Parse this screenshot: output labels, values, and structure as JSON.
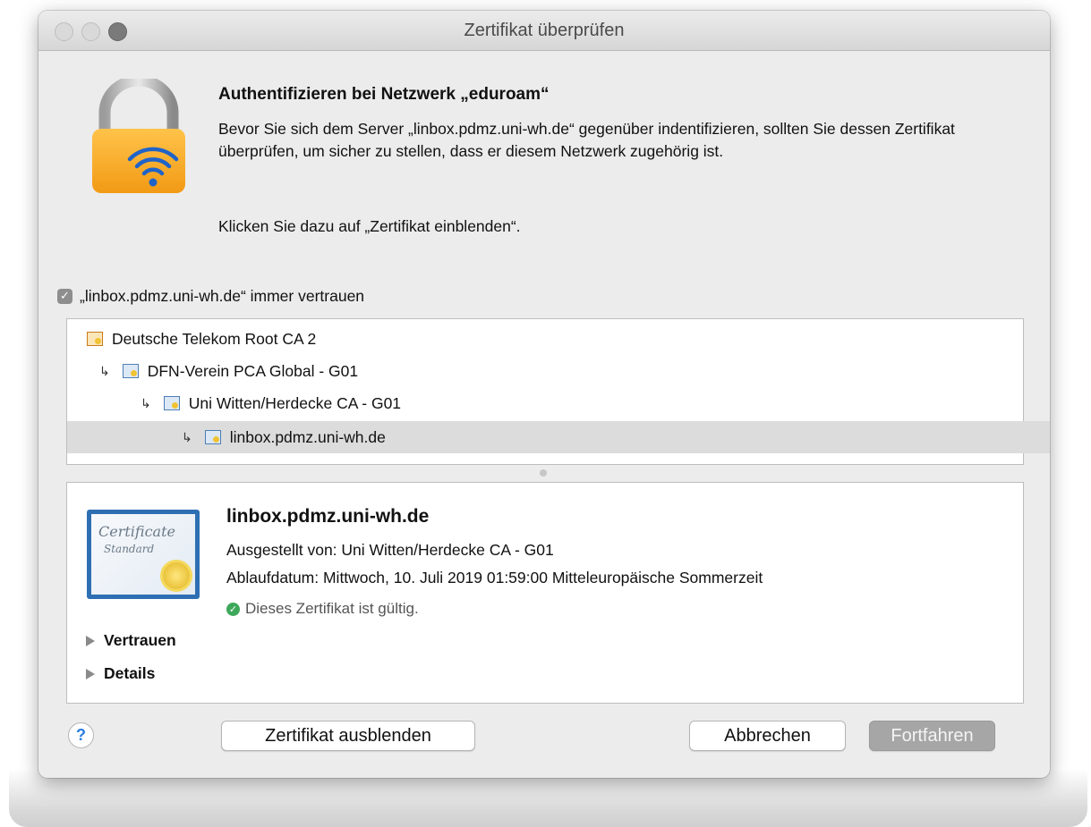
{
  "window": {
    "title": "Zertifikat überprüfen"
  },
  "header": {
    "title": "Authentifizieren bei Netzwerk „eduroam“",
    "description": "Bevor Sie sich dem Server „linbox.pdmz.uni-wh.de“ gegenüber indentifizieren, sollten Sie dessen Zertifikat überprüfen, um sicher zu stellen, dass er diesem Netzwerk zugehörig ist.",
    "instruction": "Klicken Sie dazu auf „Zertifikat einblenden“."
  },
  "trust_checkbox": {
    "label": "„linbox.pdmz.uni-wh.de“ immer vertrauen",
    "checked": true
  },
  "cert_chain": [
    {
      "label": "Deutsche Telekom Root CA 2",
      "depth": 0,
      "selected": false
    },
    {
      "label": "DFN-Verein PCA Global - G01",
      "depth": 1,
      "selected": false
    },
    {
      "label": "Uni Witten/Herdecke CA - G01",
      "depth": 2,
      "selected": false
    },
    {
      "label": "linbox.pdmz.uni-wh.de",
      "depth": 3,
      "selected": true
    }
  ],
  "cert_detail": {
    "name": "linbox.pdmz.uni-wh.de",
    "issued_by": "Ausgestellt von: Uni Witten/Herdecke CA - G01",
    "expires": "Ablaufdatum: Mittwoch, 10. Juli 2019 01:59:00 Mitteleuropäische Sommerzeit",
    "status": "Dieses Zertifikat ist gültig.",
    "status_color": "#3ea85a",
    "icon_text_1": "Certificate",
    "icon_text_2": "Standard"
  },
  "disclosures": {
    "trust": "Vertrauen",
    "details": "Details"
  },
  "buttons": {
    "help": "?",
    "hide_certificate": "Zertifikat ausblenden",
    "cancel": "Abbrechen",
    "continue": "Fortfahren"
  }
}
